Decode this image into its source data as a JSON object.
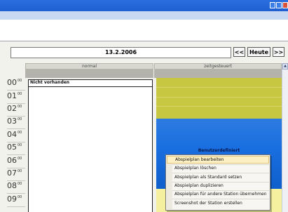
{
  "toolbar": {
    "date_value": "13.2.2006",
    "prev_label": "<<",
    "today_label": "Heute",
    "next_label": ">>"
  },
  "grid": {
    "columns": [
      "normal",
      "zeitgesteuert"
    ],
    "left_entry_label": "Nicht vorhanden",
    "right_block_label": "Benutzerdefiniert",
    "hours": [
      "00",
      "01",
      "02",
      "03",
      "04",
      "05",
      "06",
      "07",
      "08",
      "09"
    ],
    "minute_suffix": "00"
  },
  "context_menu": {
    "items": [
      "Abspielplan bearbeiten",
      "Abspielplan löschen",
      "Abspielplan als Standard setzen",
      "Abspielplan duplizieren",
      "Abspielplan für andere Station übernehmen",
      "Screenshot der Station erstellen"
    ]
  },
  "colors": {
    "titlebar": "#1f5fd2",
    "olive_block": "#c7c742",
    "blue_block": "#1a6fe0",
    "yellow_block": "#f5f0a0",
    "menu_highlight": "#fcefc4"
  }
}
